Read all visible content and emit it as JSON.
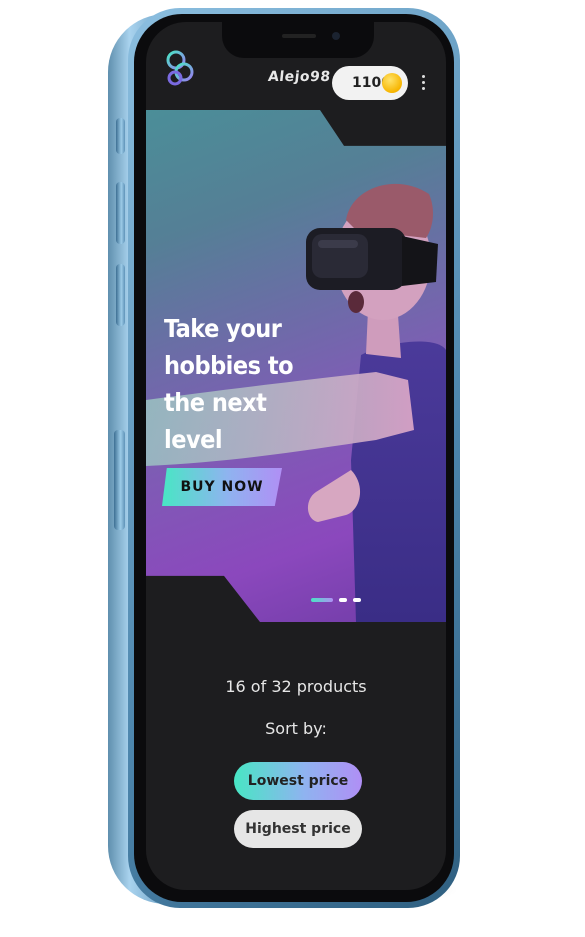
{
  "header": {
    "username": "Alejo98",
    "coins": "1100"
  },
  "hero": {
    "title": "Take your hobbies to the next level",
    "cta_label": "BUY NOW",
    "slides_total": 3,
    "active_slide": 1
  },
  "listing": {
    "count_text": "16 of 32 products",
    "sort_label": "Sort by:",
    "sort_options": [
      "Lowest price",
      "Highest price"
    ]
  },
  "colors": {
    "accent_teal": "#48e6c4",
    "accent_purple": "#b08ff5",
    "background": "#1d1d1f",
    "coin": "#f7b500"
  }
}
